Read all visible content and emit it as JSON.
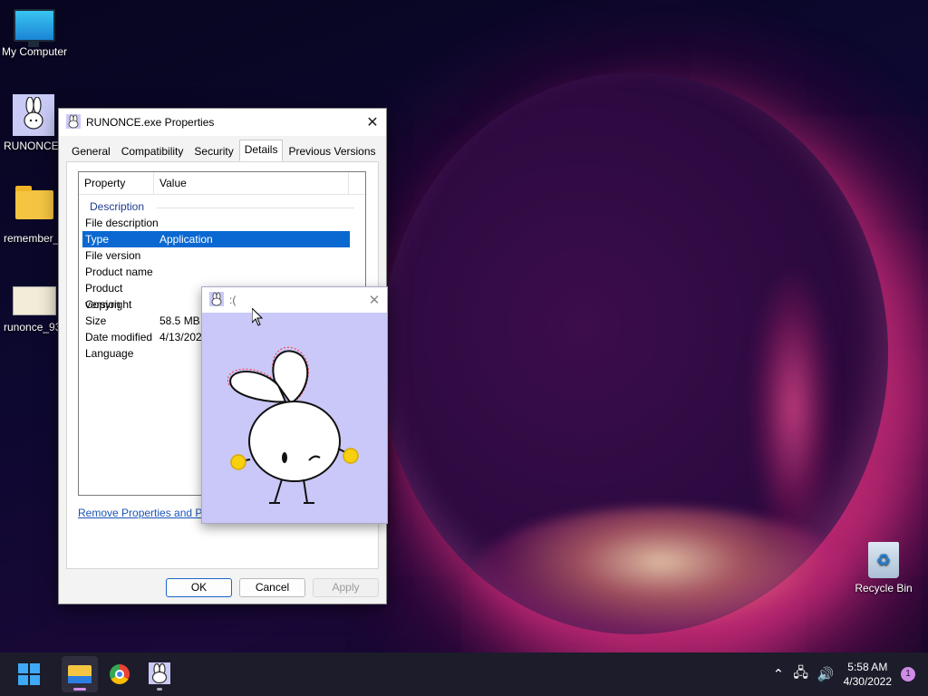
{
  "desktop": {
    "icons": [
      {
        "label": "My Computer"
      },
      {
        "label": "RUNONCE."
      },
      {
        "label": "remember_"
      },
      {
        "label": "runonce_93"
      },
      {
        "label": "Recycle Bin"
      }
    ]
  },
  "properties": {
    "title": "RUNONCE.exe Properties",
    "tabs": [
      "General",
      "Compatibility",
      "Security",
      "Details",
      "Previous Versions"
    ],
    "active_tab": "Details",
    "columns": {
      "property": "Property",
      "value": "Value"
    },
    "group": "Description",
    "rows": [
      {
        "k": "File description",
        "v": ""
      },
      {
        "k": "Type",
        "v": "Application"
      },
      {
        "k": "File version",
        "v": ""
      },
      {
        "k": "Product name",
        "v": ""
      },
      {
        "k": "Product version",
        "v": ""
      },
      {
        "k": "Copyright",
        "v": ""
      },
      {
        "k": "Size",
        "v": "58.5 MB"
      },
      {
        "k": "Date modified",
        "v": "4/13/2022"
      },
      {
        "k": "Language",
        "v": ""
      }
    ],
    "link": "Remove Properties and Perso",
    "buttons": {
      "ok": "OK",
      "cancel": "Cancel",
      "apply": "Apply"
    }
  },
  "popup": {
    "title": ":("
  },
  "taskbar": {
    "time": "5:58 AM",
    "date": "4/30/2022",
    "notifications": "1"
  },
  "colors": {
    "selection": "#0a68d0",
    "popup_bg": "#c9c8f8",
    "taskbar": "#1c1c2a"
  }
}
